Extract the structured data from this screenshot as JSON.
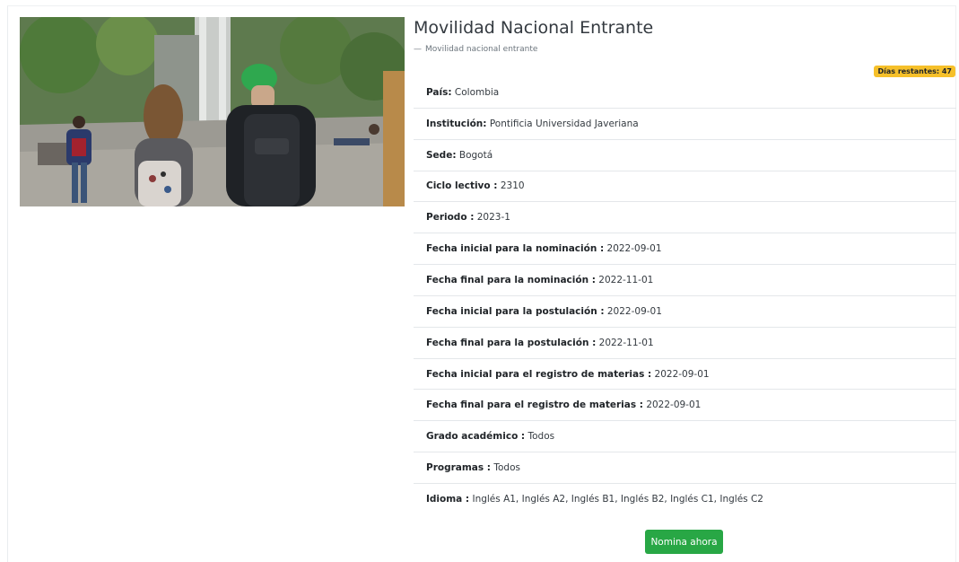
{
  "header": {
    "title": "Movilidad Nacional Entrante",
    "subtitle": "Movilidad nacional entrante",
    "subtitle_dash": "—"
  },
  "badge": {
    "label": "Días restantes: 47",
    "color": "#f6c02a"
  },
  "details": [
    {
      "key": "País:",
      "value": "Colombia"
    },
    {
      "key": "Institución:",
      "value": "Pontificia Universidad Javeriana"
    },
    {
      "key": "Sede:",
      "value": "Bogotá"
    },
    {
      "key": "Ciclo lectivo :",
      "value": "2310"
    },
    {
      "key": "Periodo :",
      "value": "2023-1"
    },
    {
      "key": "Fecha inicial para la nominación :",
      "value": "2022-09-01"
    },
    {
      "key": "Fecha final para la nominación :",
      "value": "2022-11-01"
    },
    {
      "key": "Fecha inicial para la postulación :",
      "value": "2022-09-01"
    },
    {
      "key": "Fecha final para la postulación :",
      "value": "2022-11-01"
    },
    {
      "key": "Fecha inicial para el registro de materias :",
      "value": "2022-09-01"
    },
    {
      "key": "Fecha final para el registro de materias :",
      "value": "2022-09-01"
    },
    {
      "key": "Grado académico :",
      "value": "Todos"
    },
    {
      "key": "Programas :",
      "value": "Todos"
    },
    {
      "key": "Idioma :",
      "value": "Inglés A1, Inglés A2, Inglés B1, Inglés B2, Inglés C1, Inglés C2"
    }
  ],
  "actions": {
    "nominate_label": "Nomina ahora",
    "nominate_color": "#28a745"
  }
}
